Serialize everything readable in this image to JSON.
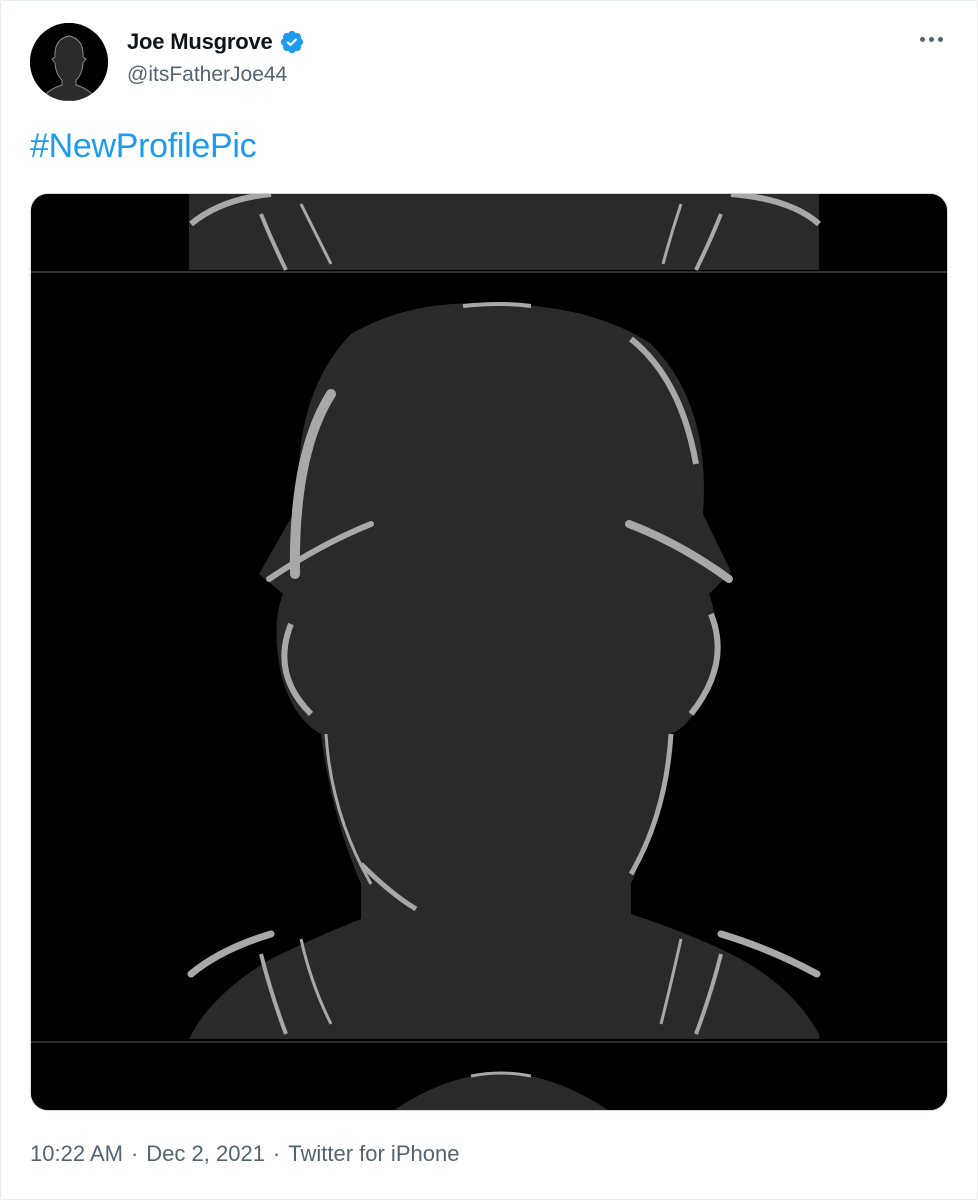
{
  "tweet": {
    "author_name": "Joe Musgrove",
    "author_handle": "@itsFatherJoe44",
    "verified": true,
    "text": "#NewProfilePic",
    "time": "10:22 AM",
    "date": "Dec 2, 2021",
    "source": "Twitter for iPhone"
  },
  "icons": {
    "verified": "verified-badge-icon",
    "more": "more-options-icon"
  },
  "colors": {
    "link": "#1d9bf0",
    "secondary_text": "#536471",
    "image_background": "#000000",
    "silhouette_fill": "#2a2a2a",
    "silhouette_highlight": "#a8a8a8"
  }
}
